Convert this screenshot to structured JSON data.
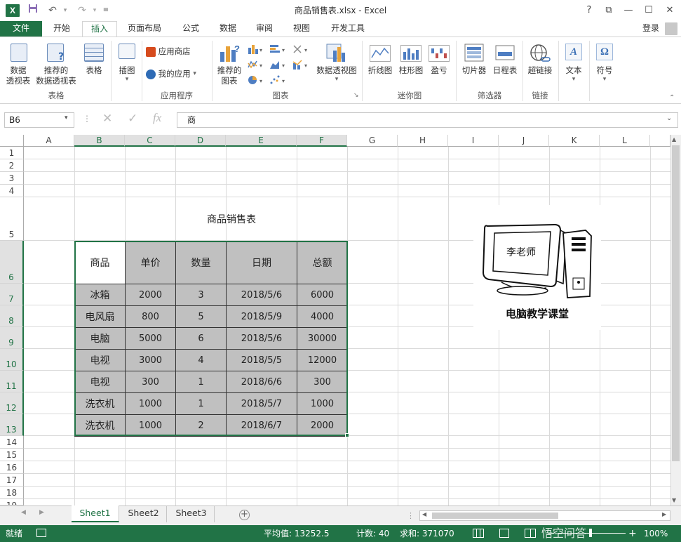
{
  "window": {
    "title": "商品销售表.xlsx - Excel",
    "logo": "X",
    "controls": [
      "?",
      "⧉",
      "—",
      "☐",
      "✕"
    ]
  },
  "tabs": {
    "file": "文件",
    "home": "开始",
    "insert": "插入",
    "layout": "页面布局",
    "formulas": "公式",
    "data": "数据",
    "review": "审阅",
    "view": "视图",
    "developer": "开发工具",
    "signin": "登录"
  },
  "ribbon": {
    "pivot": "数据\n透视表",
    "pivot_l1": "数据",
    "pivot_l2": "透视表",
    "rec_pivot_l1": "推荐的",
    "rec_pivot_l2": "数据透视表",
    "table": "表格",
    "group_table": "表格",
    "illustrations": "插图",
    "store": "应用商店",
    "myapps": "我的应用",
    "group_apps": "应用程序",
    "rec_chart_l1": "推荐的",
    "rec_chart_l2": "图表",
    "pivot_chart": "数据透视图",
    "group_charts": "图表",
    "line": "折线图",
    "column": "柱形图",
    "winloss": "盈亏",
    "group_spark": "迷你图",
    "slicer": "切片器",
    "timeline": "日程表",
    "group_filter": "筛选器",
    "hyperlink": "超链接",
    "group_links": "链接",
    "text": "文本",
    "symbol": "符号"
  },
  "formula_bar": {
    "name_box": "B6",
    "content": "商"
  },
  "columns": [
    "A",
    "B",
    "C",
    "D",
    "E",
    "F",
    "G",
    "H",
    "I",
    "J",
    "K",
    "L"
  ],
  "rows": [
    "1",
    "2",
    "3",
    "4",
    "5",
    "6",
    "7",
    "8",
    "9",
    "10",
    "11",
    "12",
    "13",
    "14",
    "15",
    "16",
    "17",
    "18",
    "19"
  ],
  "sheet": {
    "title": "商品销售表",
    "headers": [
      "商品",
      "单价",
      "数量",
      "日期",
      "总额"
    ],
    "data": [
      [
        "冰箱",
        "2000",
        "3",
        "2018/5/6",
        "6000"
      ],
      [
        "电风扇",
        "800",
        "5",
        "2018/5/9",
        "4000"
      ],
      [
        "电脑",
        "5000",
        "6",
        "2018/5/6",
        "30000"
      ],
      [
        "电视",
        "3000",
        "4",
        "2018/5/5",
        "12000"
      ],
      [
        "电视",
        "300",
        "1",
        "2018/6/6",
        "300"
      ],
      [
        "洗衣机",
        "1000",
        "1",
        "2018/5/7",
        "1000"
      ],
      [
        "洗衣机",
        "1000",
        "2",
        "2018/6/7",
        "2000"
      ]
    ]
  },
  "logo_image": {
    "screen_text": "李老师",
    "caption": "电脑教学课堂"
  },
  "sheet_tabs": [
    "Sheet1",
    "Sheet2",
    "Sheet3"
  ],
  "status": {
    "ready": "就绪",
    "average": "平均值: 13252.5",
    "count": "计数: 40",
    "sum": "求和: 371070",
    "zoom": "100%",
    "watermark": "悟空问答"
  }
}
